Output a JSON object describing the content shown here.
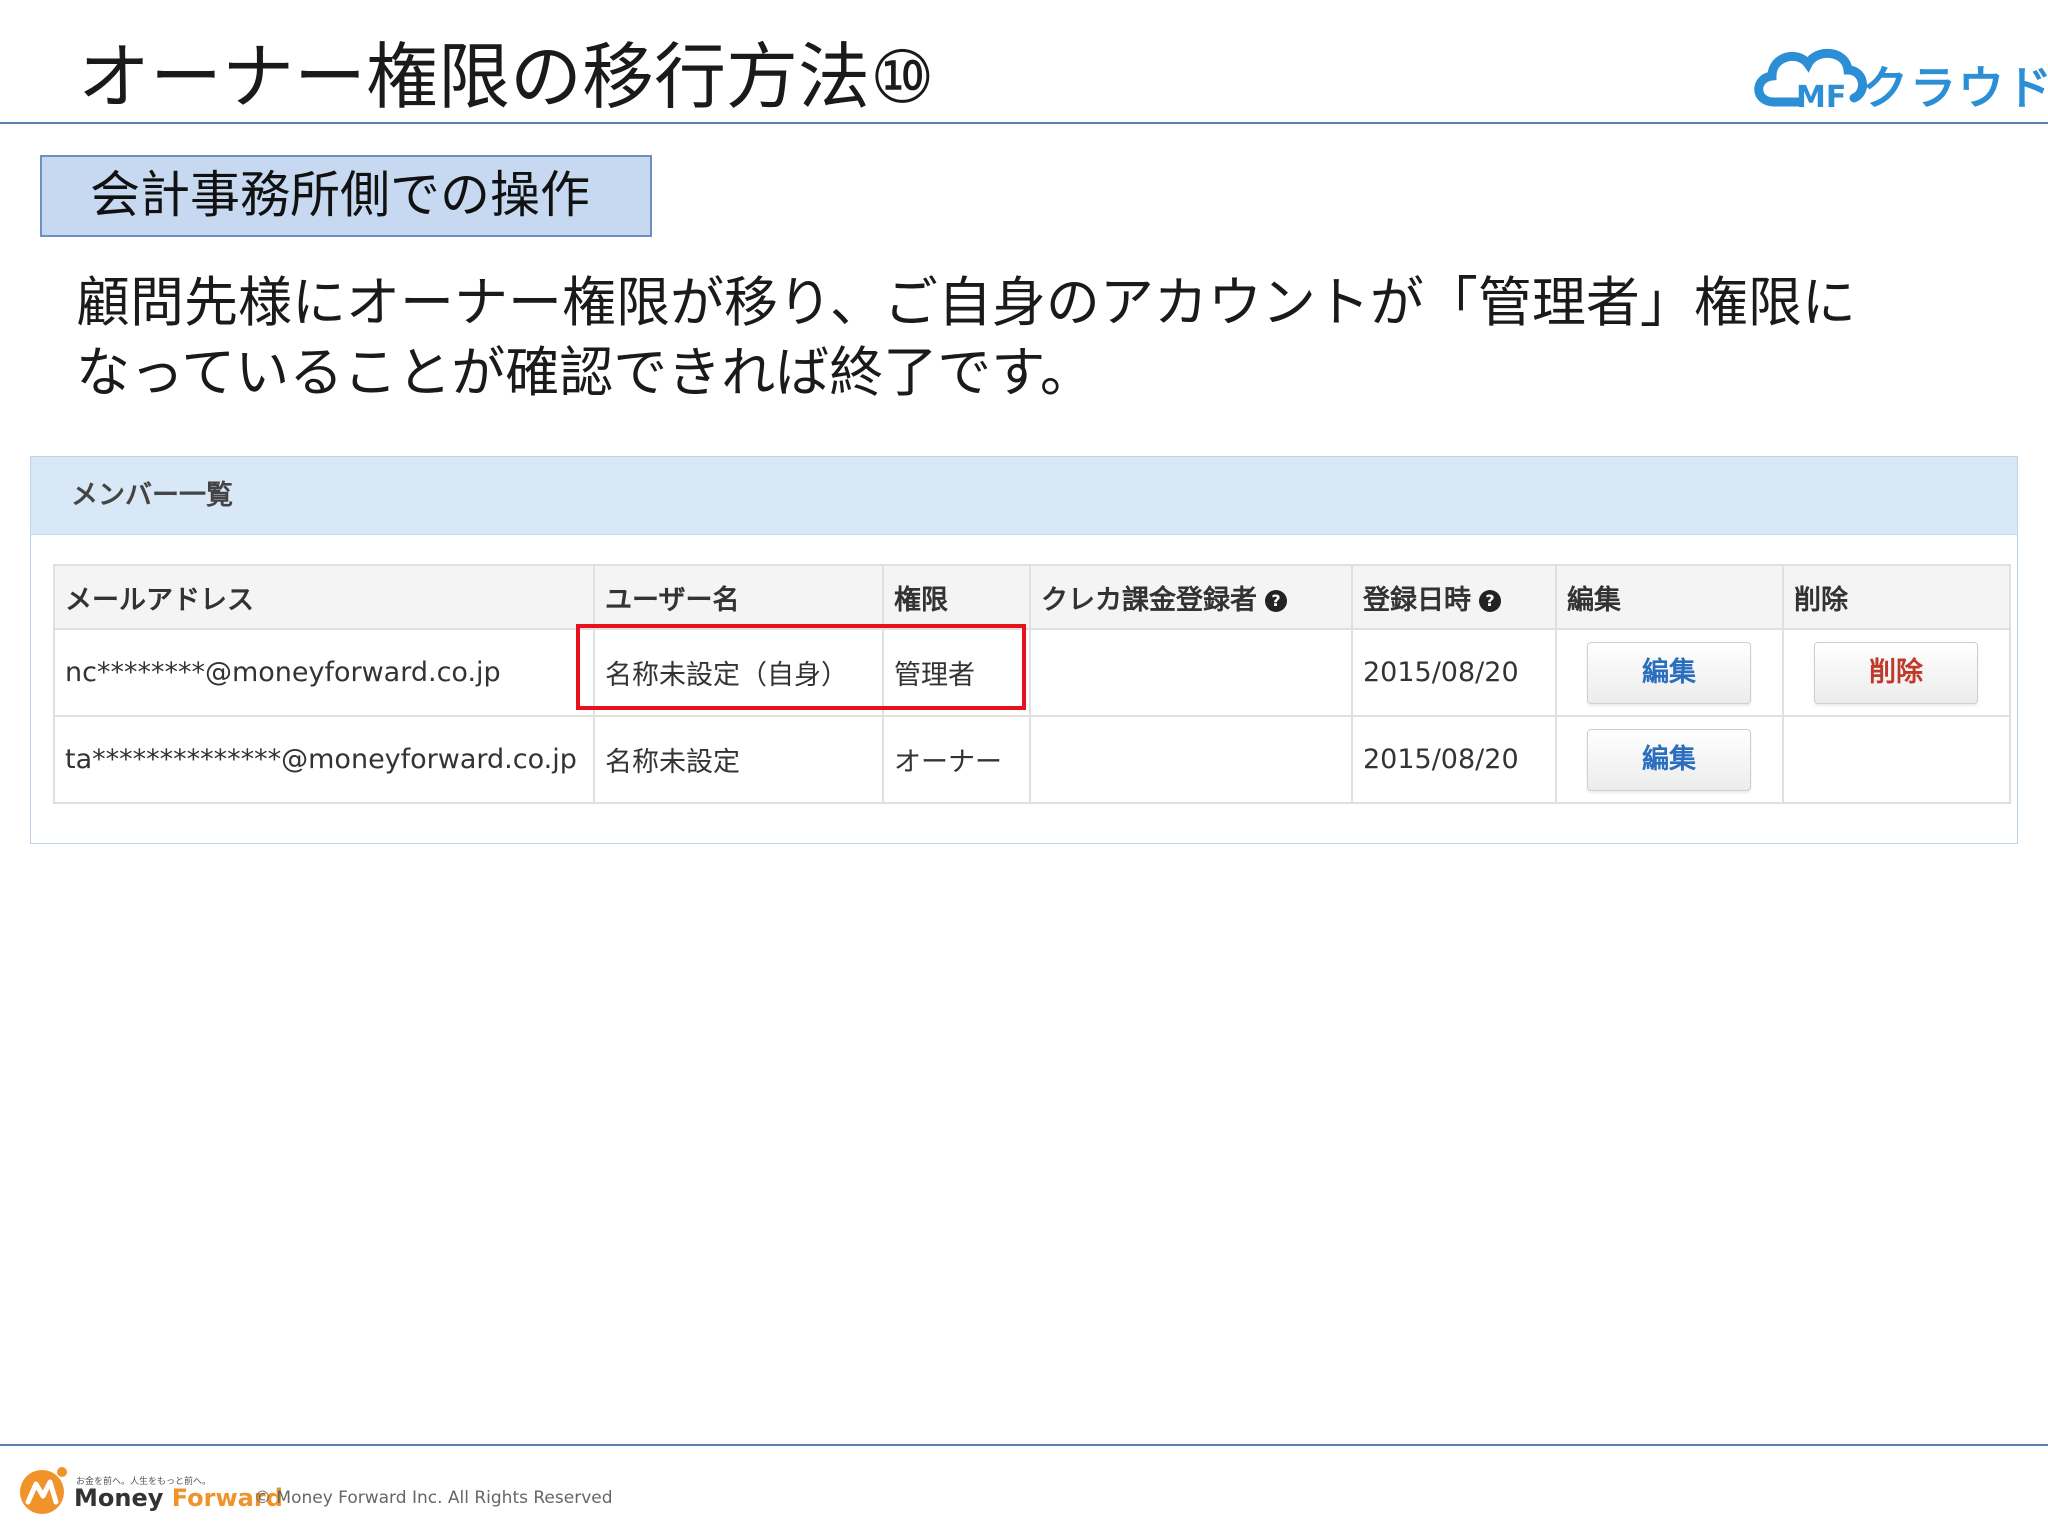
{
  "header": {
    "title": "オーナー権限の移行方法⑩",
    "logo_text": "クラウド",
    "logo_badge": "MF"
  },
  "section_label": "会計事務所側での操作",
  "description": {
    "line1": "顧問先様にオーナー権限が移り、ご自身のアカウントが「管理者」権限に",
    "line2": "なっていることが確認できれば終了です。"
  },
  "panel": {
    "title": "メンバー一覧",
    "columns": [
      "メールアドレス",
      "ユーザー名",
      "権限",
      "クレカ課金登録者",
      "登録日時",
      "編集",
      "削除"
    ],
    "help_icon": "?",
    "rows": [
      {
        "email": "nc********@moneyforward.co.jp",
        "username": "名称未設定（自身）",
        "role": "管理者",
        "card": "",
        "date": "2015/08/20",
        "edit_label": "編集",
        "delete_label": "削除"
      },
      {
        "email": "ta**************@moneyforward.co.jp",
        "username": "名称未設定",
        "role": "オーナー",
        "card": "",
        "date": "2015/08/20",
        "edit_label": "編集",
        "delete_label": ""
      }
    ]
  },
  "footer": {
    "tagline": "お金を前へ。人生をもっと前へ。",
    "brand_money": "Money",
    "brand_forward": "Forward",
    "copyright": "© Money Forward Inc. All Rights Reserved"
  },
  "colors": {
    "accent_blue": "#2c8fd6",
    "highlight_red": "#e8101a",
    "section_bg": "#c6d9f1",
    "panel_header_bg": "#d9e8f6",
    "brand_orange": "#f0932b"
  },
  "icons": [
    "cloud-icon",
    "help-circle-icon",
    "money-forward-logo-icon"
  ]
}
